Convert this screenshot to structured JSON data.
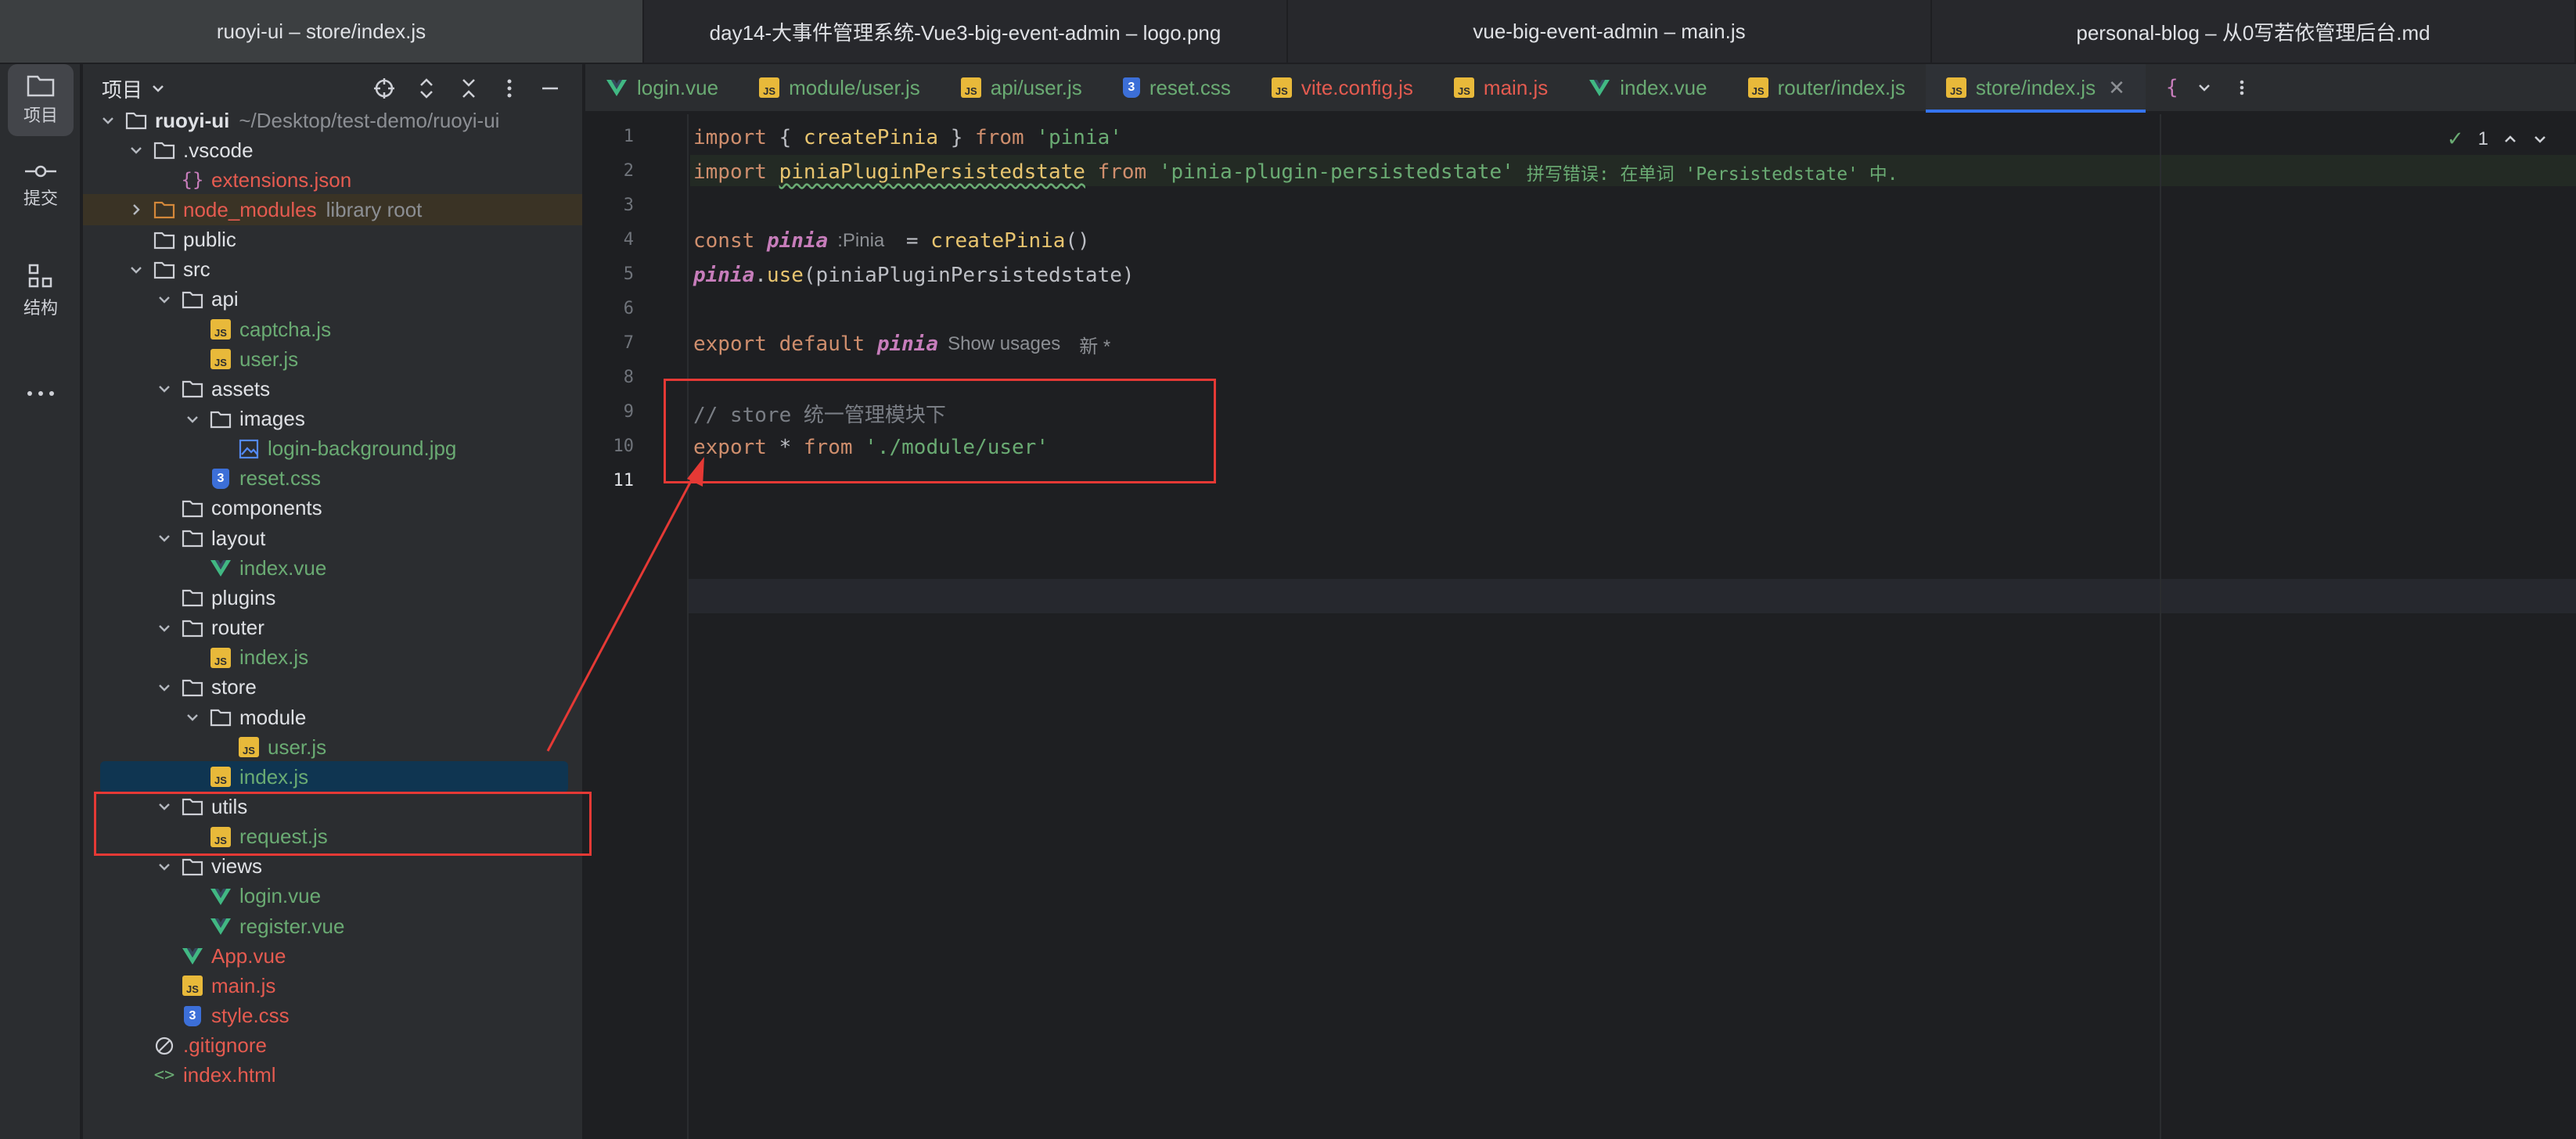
{
  "window_tabs": [
    {
      "label": "ruoyi-ui – store/index.js",
      "active": true
    },
    {
      "label": "day14-大事件管理系统-Vue3-big-event-admin – logo.png",
      "active": false
    },
    {
      "label": "vue-big-event-admin – main.js",
      "active": false
    },
    {
      "label": "personal-blog – 从0写若依管理后台.md",
      "active": false
    }
  ],
  "activity_bar": [
    {
      "label": "项目",
      "icon": "folder-icon",
      "active": true
    },
    {
      "label": "提交",
      "icon": "commit-icon",
      "active": false
    },
    {
      "label": "结构",
      "icon": "structure-icon",
      "active": false
    }
  ],
  "project_panel": {
    "title": "项目",
    "tree": [
      {
        "label": "ruoyi-ui",
        "hint": "~/Desktop/test-demo/ruoyi-ui",
        "kind": "folder",
        "depth": 0,
        "open": true,
        "color": "folder",
        "bold": true
      },
      {
        "label": ".vscode",
        "kind": "folder",
        "depth": 1,
        "open": true,
        "color": "folder"
      },
      {
        "label": "extensions.json",
        "kind": "json",
        "depth": 2,
        "color": "red"
      },
      {
        "label": "node_modules",
        "hint": "library root",
        "kind": "folder-orange",
        "depth": 1,
        "open": false,
        "color": "red",
        "excluded": true
      },
      {
        "label": "public",
        "kind": "folder",
        "depth": 1,
        "color": "folder",
        "leaf": true
      },
      {
        "label": "src",
        "kind": "folder",
        "depth": 1,
        "open": true,
        "color": "folder"
      },
      {
        "label": "api",
        "kind": "folder",
        "depth": 2,
        "open": true,
        "color": "folder"
      },
      {
        "label": "captcha.js",
        "kind": "js",
        "depth": 3,
        "color": "js"
      },
      {
        "label": "user.js",
        "kind": "js",
        "depth": 3,
        "color": "js"
      },
      {
        "label": "assets",
        "kind": "folder",
        "depth": 2,
        "open": true,
        "color": "folder"
      },
      {
        "label": "images",
        "kind": "folder",
        "depth": 3,
        "open": true,
        "color": "folder"
      },
      {
        "label": "login-background.jpg",
        "kind": "image",
        "depth": 4,
        "color": "js"
      },
      {
        "label": "reset.css",
        "kind": "css",
        "depth": 3,
        "color": "js"
      },
      {
        "label": "components",
        "kind": "folder",
        "depth": 2,
        "color": "folder",
        "leaf": true
      },
      {
        "label": "layout",
        "kind": "folder",
        "depth": 2,
        "open": true,
        "color": "folder"
      },
      {
        "label": "index.vue",
        "kind": "vue",
        "depth": 3,
        "color": "js"
      },
      {
        "label": "plugins",
        "kind": "folder",
        "depth": 2,
        "color": "folder",
        "leaf": true
      },
      {
        "label": "router",
        "kind": "folder",
        "depth": 2,
        "open": true,
        "color": "folder"
      },
      {
        "label": "index.js",
        "kind": "js",
        "depth": 3,
        "color": "js"
      },
      {
        "label": "store",
        "kind": "folder",
        "depth": 2,
        "open": true,
        "color": "folder"
      },
      {
        "label": "module",
        "kind": "folder",
        "depth": 3,
        "open": true,
        "color": "folder"
      },
      {
        "label": "user.js",
        "kind": "js",
        "depth": 4,
        "color": "js"
      },
      {
        "label": "index.js",
        "kind": "js",
        "depth": 3,
        "color": "js",
        "selected": true
      },
      {
        "label": "utils",
        "kind": "folder",
        "depth": 2,
        "open": true,
        "color": "folder"
      },
      {
        "label": "request.js",
        "kind": "js",
        "depth": 3,
        "color": "js"
      },
      {
        "label": "views",
        "kind": "folder",
        "depth": 2,
        "open": true,
        "color": "folder"
      },
      {
        "label": "login.vue",
        "kind": "vue",
        "depth": 3,
        "color": "js"
      },
      {
        "label": "register.vue",
        "kind": "vue",
        "depth": 3,
        "color": "js"
      },
      {
        "label": "App.vue",
        "kind": "vue",
        "depth": 2,
        "color": "red"
      },
      {
        "label": "main.js",
        "kind": "js",
        "depth": 2,
        "color": "red"
      },
      {
        "label": "style.css",
        "kind": "css",
        "depth": 2,
        "color": "red"
      },
      {
        "label": ".gitignore",
        "kind": "ignore",
        "depth": 1,
        "color": "red"
      },
      {
        "label": "index.html",
        "kind": "html",
        "depth": 1,
        "color": "red"
      }
    ]
  },
  "editor_tabs": [
    {
      "label": "login.vue",
      "icon": "vue",
      "color": "green"
    },
    {
      "label": "module/user.js",
      "icon": "js",
      "color": "green"
    },
    {
      "label": "api/user.js",
      "icon": "js",
      "color": "green"
    },
    {
      "label": "reset.css",
      "icon": "css",
      "color": "green"
    },
    {
      "label": "vite.config.js",
      "icon": "js",
      "color": "red"
    },
    {
      "label": "main.js",
      "icon": "js",
      "color": "red"
    },
    {
      "label": "index.vue",
      "icon": "vue",
      "color": "green"
    },
    {
      "label": "router/index.js",
      "icon": "js",
      "color": "green"
    },
    {
      "label": "store/index.js",
      "icon": "js",
      "color": "green",
      "active": true
    }
  ],
  "editor": {
    "inspection_count": "1",
    "current_line": 11,
    "line_numbers": [
      "1",
      "2",
      "3",
      "4",
      "5",
      "6",
      "7",
      "8",
      "9",
      "10",
      "11"
    ],
    "lines": [
      [
        {
          "t": "import",
          "c": "kw"
        },
        {
          "t": " { ",
          "c": "punc"
        },
        {
          "t": "createPinia",
          "c": "id-y"
        },
        {
          "t": " } ",
          "c": "punc"
        },
        {
          "t": "from",
          "c": "kw"
        },
        {
          "t": " ",
          "c": "punc"
        },
        {
          "t": "'pinia'",
          "c": "str"
        }
      ],
      [
        {
          "t": "import",
          "c": "kw"
        },
        {
          "t": " ",
          "c": "punc"
        },
        {
          "t": "piniaPluginPersistedstate",
          "c": "id-y squiggle"
        },
        {
          "t": " ",
          "c": "punc"
        },
        {
          "t": "from",
          "c": "kw"
        },
        {
          "t": " ",
          "c": "punc"
        },
        {
          "t": "'pinia-plugin-persistedstate'",
          "c": "str"
        },
        {
          "t": "拼写错误: 在单词 'Persistedstate' 中.",
          "c": "typo"
        }
      ],
      [],
      [
        {
          "t": "const",
          "c": "kw"
        },
        {
          "t": " ",
          "c": "punc"
        },
        {
          "t": "pinia",
          "c": "var"
        },
        {
          "t": ":Pinia",
          "c": "inlay"
        },
        {
          "t": " = ",
          "c": "punc"
        },
        {
          "t": "createPinia",
          "c": "id-y"
        },
        {
          "t": "()",
          "c": "punc"
        }
      ],
      [
        {
          "t": "pinia",
          "c": "var"
        },
        {
          "t": ".",
          "c": "punc"
        },
        {
          "t": "use",
          "c": "id-y"
        },
        {
          "t": "(piniaPluginPersistedstate)",
          "c": "punc"
        }
      ],
      [],
      [
        {
          "t": "export",
          "c": "kw"
        },
        {
          "t": " ",
          "c": "punc"
        },
        {
          "t": "default",
          "c": "kw"
        },
        {
          "t": " ",
          "c": "punc"
        },
        {
          "t": "pinia",
          "c": "var"
        },
        {
          "t": "Show usages",
          "c": "inlay"
        },
        {
          "t": "新 *",
          "c": "inlay"
        }
      ],
      [],
      [
        {
          "t": "// store 统一管理模块下",
          "c": "cmt"
        }
      ],
      [
        {
          "t": "export",
          "c": "kw"
        },
        {
          "t": " * ",
          "c": "punc"
        },
        {
          "t": "from",
          "c": "kw"
        },
        {
          "t": " ",
          "c": "punc"
        },
        {
          "t": "'./module/user'",
          "c": "str"
        }
      ],
      []
    ]
  },
  "colors": {
    "annotation_red": "#e53935",
    "selection_blue": "#0f3551",
    "accent_blue": "#3574f0"
  }
}
